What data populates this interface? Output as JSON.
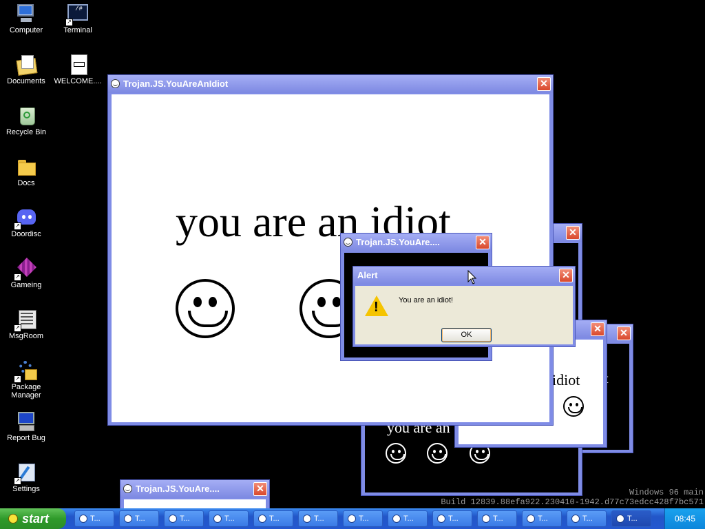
{
  "desktop_icons": [
    {
      "label": "Computer",
      "icon": "computer-icon"
    },
    {
      "label": "Terminal",
      "icon": "terminal-icon"
    },
    {
      "label": "Documents",
      "icon": "documents-icon"
    },
    {
      "label": "WELCOME....",
      "icon": "text-file-icon"
    },
    {
      "label": "Recycle Bin",
      "icon": "recycle-bin-icon"
    },
    {
      "label": "Docs",
      "icon": "folder-icon"
    },
    {
      "label": "Doordisc",
      "icon": "discord-icon"
    },
    {
      "label": "Gameing",
      "icon": "game-cube-icon"
    },
    {
      "label": "MsgRoom",
      "icon": "msgroom-icon"
    },
    {
      "label": "Package Manager",
      "icon": "package-manager-icon"
    },
    {
      "label": "Report Bug",
      "icon": "report-bug-icon"
    },
    {
      "label": "Settings",
      "icon": "settings-icon"
    }
  ],
  "terminal_glyph": "/#",
  "windows": {
    "main_title": "Trojan.JS.YouAreAnIdiot",
    "mid_title": "Trojan.JS.YouAre....",
    "bottom_title": "Trojan.JS.YouAre....",
    "idiot_text": "you are an idiot",
    "idiot_text_partial": "you are an",
    "idiot_text_word": "idiot",
    "close_glyph": "✕"
  },
  "alert": {
    "title": "Alert",
    "message": "You are an idiot!",
    "ok_label": "OK",
    "warn_glyph": "!"
  },
  "taskbar": {
    "start_label": "start",
    "task_label": "T...",
    "task_count": 13,
    "clock": "08:45"
  },
  "watermark": {
    "line1": "Windows 96 main",
    "line2": "Build 12839.88efa922.230410-1942.d77c73edcc428f7bc571"
  }
}
